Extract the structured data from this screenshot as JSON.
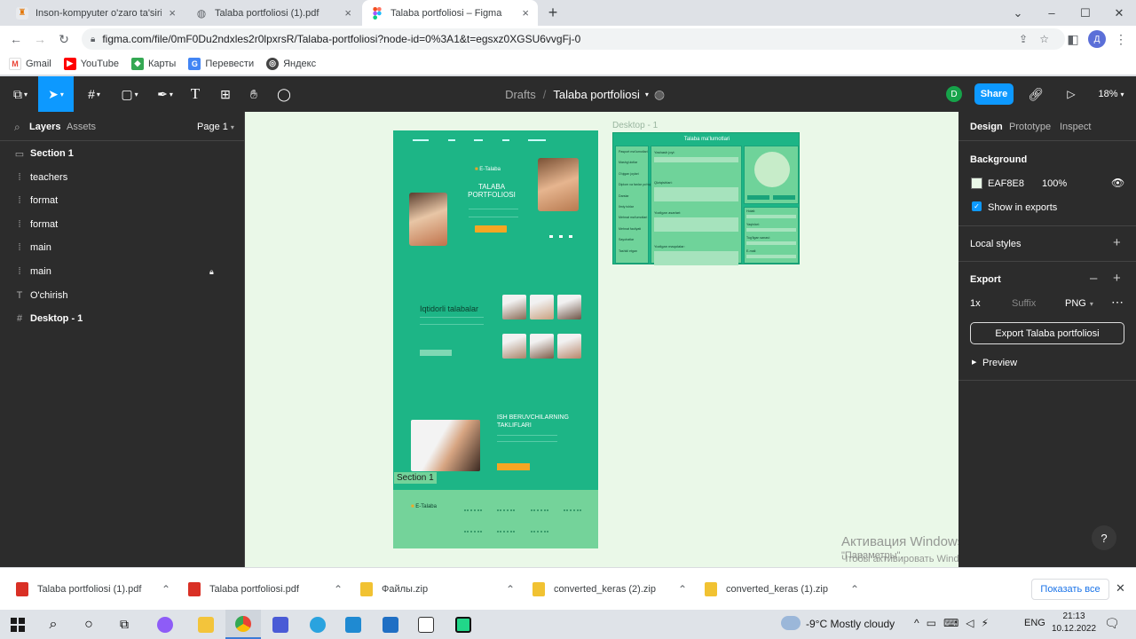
{
  "browser": {
    "tabs": [
      {
        "title": "Inson-kompyuter o'zaro ta'siri (c",
        "close": "×"
      },
      {
        "title": "Talaba portfoliosi (1).pdf",
        "close": "×"
      },
      {
        "title": "Talaba portfoliosi – Figma",
        "close": "×"
      }
    ],
    "new_tab": "+",
    "window_controls": {
      "chevron": "⌄",
      "minimize": "–",
      "maximize": "☐",
      "close": "✕"
    },
    "url": "figma.com/file/0mF0Du2ndxles2r0lpxrsR/Talaba-portfoliosi?node-id=0%3A1&t=egsxz0XGSU6vvgFj-0",
    "profile_initial": "Д",
    "bookmarks": [
      "Gmail",
      "YouTube",
      "Карты",
      "Перевести",
      "Яндекс"
    ]
  },
  "figma": {
    "breadcrumb_root": "Drafts",
    "breadcrumb_sep": "/",
    "file_name": "Talaba portfoliosi",
    "user_initial": "D",
    "share_label": "Share",
    "zoom": "18%",
    "left_tabs": {
      "layers": "Layers",
      "assets": "Assets",
      "page": "Page 1"
    },
    "layers": [
      {
        "name": "Section 1",
        "icon": "section-icon",
        "bold": true
      },
      {
        "name": "teachers",
        "icon": "group-icon",
        "bold": false
      },
      {
        "name": "format",
        "icon": "group-icon",
        "bold": false
      },
      {
        "name": "format",
        "icon": "group-icon",
        "bold": false
      },
      {
        "name": "main",
        "icon": "group-icon",
        "bold": false
      },
      {
        "name": "main",
        "icon": "group-icon",
        "bold": false,
        "locked": true
      },
      {
        "name": "O'chirish",
        "icon": "text-icon",
        "bold": false
      },
      {
        "name": "Desktop - 1",
        "icon": "frame-icon",
        "bold": true
      }
    ],
    "right_tabs": {
      "design": "Design",
      "prototype": "Prototype",
      "inspect": "Inspect"
    },
    "background": {
      "label": "Background",
      "hex": "EAF8E8",
      "opacity": "100%",
      "color": "#eaf8e8",
      "show_in_exports": "Show in exports"
    },
    "local_styles": "Local styles",
    "export": {
      "label": "Export",
      "scale": "1x",
      "suffix": "Suffix",
      "format": "PNG",
      "button": "Export Talaba portfoliosi",
      "preview": "Preview"
    },
    "help": "?"
  },
  "canvas": {
    "frame_label": "Desktop - 1",
    "section_label": "Section 1",
    "design": {
      "brand": "E-Talaba",
      "hero_title_1": "TALABA",
      "hero_title_2": "PORTFOLIOSI",
      "talented": "Iqtidorli talabalar",
      "employers_1": "ISH BERUVCHILARNING",
      "employers_2": "TAKLIFLARI",
      "footer_brand": "E-Talaba",
      "accent": "#1db586",
      "orange": "#f5a623"
    },
    "form": {
      "title": "Talaba ma'lumotlari",
      "sidebar_items": [
        "Pasport ma'lumotlari",
        "Mashg'ulotlar",
        "O'qigan joylari",
        "Diplom va fanlar yo'riqlari",
        "Darslar",
        "Ilmiy ishlar",
        "Mehnat ma'lumotlari",
        "Mehnat faoliyati",
        "Sayohatlar",
        "Tashkil etgan"
      ],
      "fields": [
        "Yashash joyi:",
        "Qiziqishlari:",
        "Yozilgan asarlari:",
        "Yozilgan maqolalar:"
      ],
      "right_fields": [
        "Holati:",
        "Yaqinlari:",
        "Tug'ilgan sanasi:",
        "E-mail:"
      ]
    }
  },
  "activation": {
    "title": "Активация Windows",
    "line1": "Чтобы активировать Windows, перейдите в раздел",
    "line2": "\"Параметры\"."
  },
  "downloads": {
    "items": [
      "Talaba portfoliosi (1).pdf",
      "Talaba portfoliosi.pdf",
      "Файлы.zip",
      "converted_keras (2).zip",
      "converted_keras (1).zip"
    ],
    "show_all": "Показать все",
    "close": "✕"
  },
  "taskbar": {
    "weather": "-9°C  Mostly cloudy",
    "lang": "ENG",
    "time": "21:13",
    "date": "10.12.2022"
  }
}
